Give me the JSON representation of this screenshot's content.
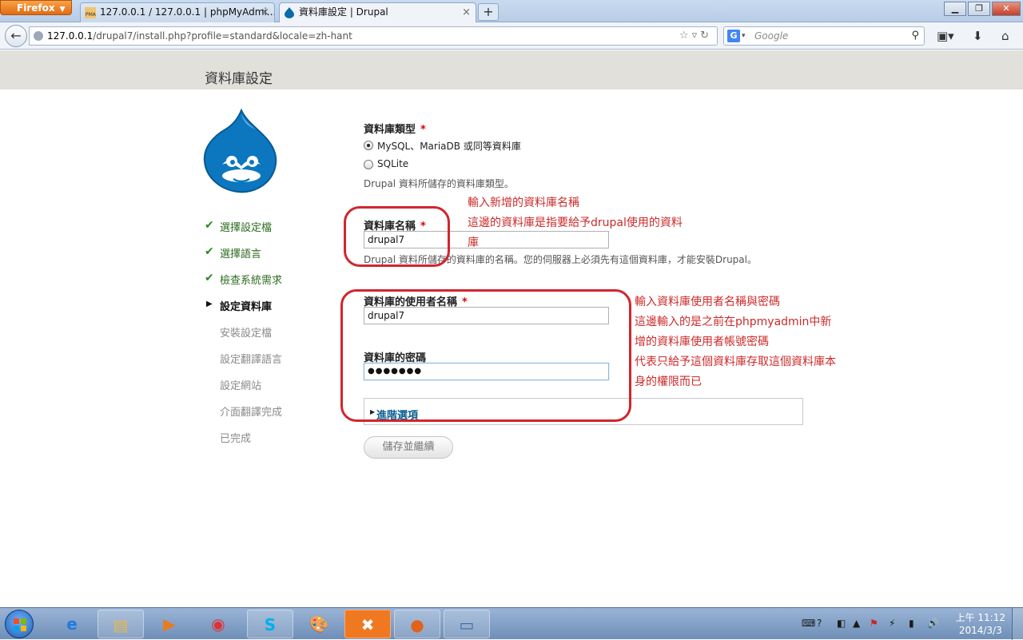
{
  "browser": {
    "app_button": "Firefox",
    "tabs": [
      {
        "label": "127.0.0.1 / 127.0.0.1 | phpMyAdmi...",
        "favicon_text": "PMA",
        "active": false
      },
      {
        "label": "資料庫設定 | Drupal",
        "active": true
      }
    ],
    "url": {
      "host": "127.0.0.1",
      "path": "/drupal7/install.php?profile=standard&locale=zh-hant"
    },
    "search": {
      "engine": "G",
      "placeholder": "Google"
    }
  },
  "page": {
    "title": "資料庫設定",
    "steps": [
      {
        "label": "選擇設定檔",
        "state": "done"
      },
      {
        "label": "選擇語言",
        "state": "done"
      },
      {
        "label": "檢查系統需求",
        "state": "done"
      },
      {
        "label": "設定資料庫",
        "state": "current"
      },
      {
        "label": "安裝設定檔",
        "state": "todo"
      },
      {
        "label": "設定翻譯語言",
        "state": "todo"
      },
      {
        "label": "設定網站",
        "state": "todo"
      },
      {
        "label": "介面翻譯完成",
        "state": "todo"
      },
      {
        "label": "已完成",
        "state": "todo"
      }
    ],
    "form": {
      "db_type": {
        "label": "資料庫類型",
        "options": [
          "MySQL、MariaDB 或同等資料庫",
          "SQLite"
        ],
        "selected": "MySQL、MariaDB 或同等資料庫",
        "description": "Drupal 資料所儲存的資料庫類型。"
      },
      "db_name": {
        "label": "資料庫名稱",
        "value": "drupal7",
        "description": "Drupal 資料所儲存的資料庫的名稱。您的伺服器上必須先有這個資料庫，才能安裝Drupal。"
      },
      "db_user": {
        "label": "資料庫的使用者名稱",
        "value": "drupal7"
      },
      "db_pass": {
        "label": "資料庫的密碼",
        "value": "●●●●●●●"
      },
      "advanced": "進階選項",
      "submit": "儲存並繼續"
    },
    "required_mark": "*"
  },
  "annotations": {
    "name_note": [
      "輸入新增的資料庫名稱",
      "這邊的資料庫是指要給予drupal使用的資料",
      "庫"
    ],
    "user_note": [
      "輸入資料庫使用者名稱與密碼",
      "這邊輸入的是之前在phpmyadmin中新",
      "增的資料庫使用者帳號密碼",
      "代表只給予這個資料庫存取這個資料庫本",
      "身的權限而已"
    ],
    "color": "#cc2a2a"
  },
  "taskbar": {
    "clock_time": "上午 11:12",
    "clock_date": "2014/3/3"
  }
}
